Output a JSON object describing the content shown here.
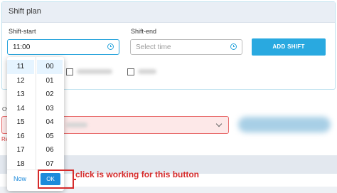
{
  "panel": {
    "title": "Shift plan"
  },
  "shift_start": {
    "label": "Shift-start",
    "value": "11:00"
  },
  "shift_end": {
    "label": "Shift-end",
    "placeholder": "Select time"
  },
  "add_shift": {
    "label": "ADD SHIFT"
  },
  "other": {
    "prefix": "Ov",
    "error_prefix": "Re"
  },
  "picker": {
    "hours": [
      "11",
      "12",
      "13",
      "14",
      "15",
      "16",
      "17",
      "18"
    ],
    "minutes": [
      "00",
      "01",
      "02",
      "03",
      "04",
      "05",
      "06",
      "07"
    ],
    "selected_hour": "11",
    "selected_minute": "00",
    "now_label": "Now",
    "ok_label": "OK"
  },
  "annotation": {
    "text": "click is working for this button"
  },
  "colors": {
    "accent": "#29a9e0",
    "annotation": "#d62b2b",
    "error_bg": "#fde8e8"
  },
  "icons": [
    "clock-icon",
    "chevron-down-icon"
  ]
}
